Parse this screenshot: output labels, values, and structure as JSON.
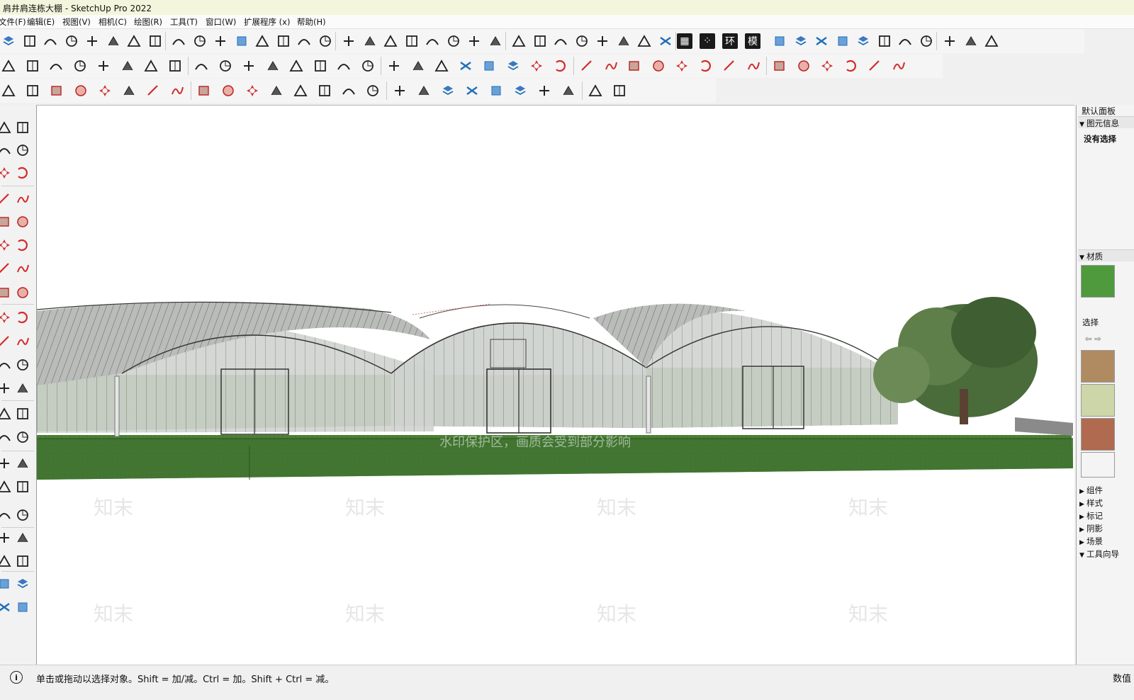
{
  "window": {
    "title": "肩井肩连栋大棚 - SketchUp Pro 2022"
  },
  "menu": [
    "文件(F)",
    "编辑(E)",
    "视图(V)",
    "相机(C)",
    "绘图(R)",
    "工具(T)",
    "窗口(W)",
    "扩展程序 (x)",
    "帮助(H)"
  ],
  "toolbar_text_buttons": [
    "环",
    "模"
  ],
  "icons": {
    "row1": [
      "sandbox-icon",
      "grid-icon",
      "line-tool-icon",
      "bar-chart-icon",
      "joint-push-icon",
      "dim-icon",
      "curve-icon",
      "curve2-icon",
      "arch-icon",
      "spiral-icon",
      "flowify-icon",
      "layer-icon",
      "pen-curve-icon",
      "stack-icon",
      "stack2-icon",
      "box-icon",
      "stamp-icon",
      "arc-line-icon",
      "chain-icon",
      "wave-icon",
      "spring-icon",
      "slope-icon",
      "comb-icon",
      "rail-icon",
      "mirror-icon",
      "dots-grid-icon",
      "panel-icon",
      "compass-icon",
      "brush-icon",
      "table-icon",
      "star-field-icon",
      "iso-cube-icon",
      "cube-outline-icon",
      "face-icon",
      "shade-icon",
      "layers-icon",
      "texture-icon",
      "house1-icon",
      "door-icon",
      "house-icon",
      "gate-icon",
      "house2-icon",
      "shed-icon"
    ],
    "row2": [
      "new-icon",
      "open-icon",
      "save-icon",
      "cut-icon",
      "copy-icon",
      "paste-icon",
      "erase-icon",
      "undo-icon",
      "redo-icon",
      "print-icon",
      "model-info-icon",
      "tape-icon",
      "axis-icon",
      "protractor-icon",
      "text-icon",
      "axes-icon",
      "figure-icon",
      "component-icon",
      "group-icon",
      "layer-stack-icon",
      "blue-cube-icon",
      "blue-cube2-icon",
      "pencil-icon",
      "freehand-icon",
      "rectangle-icon",
      "rotated-rect-icon",
      "circle-icon",
      "polygon-icon",
      "arc-icon",
      "arc2-icon",
      "arc3-icon",
      "pie-icon",
      "move-icon",
      "pushpull-icon",
      "rotate-icon",
      "followme-icon",
      "scale-icon",
      "offset-icon"
    ],
    "row3": [
      "zoom-icon",
      "select-icon",
      "eraser-icon",
      "pencil-line-icon",
      "arc-tool-icon",
      "shape-icon",
      "pushpull2-icon",
      "followme2-icon",
      "move2-icon",
      "rotate2-icon",
      "scale2-icon",
      "tape2-icon",
      "text2-icon",
      "paint-icon",
      "orbit-icon",
      "pan-icon",
      "zoom2-icon",
      "zoom-extents-icon",
      "sandbox2-icon",
      "sandbox3-icon",
      "sandbox4-icon",
      "sandbox5-icon",
      "user-icon",
      "ruby-icon",
      "ext-warehouse-icon",
      "ext-manager-icon"
    ]
  },
  "right_panel": {
    "title": "默认面板",
    "entity_info": "图元信息",
    "no_selection": "没有选择",
    "materials": "材质",
    "select_tab": "选择",
    "collapsed_sections": [
      "组件",
      "样式",
      "标记",
      "阴影",
      "场景",
      "工具向导"
    ]
  },
  "watermark": {
    "brand": "知末",
    "notice": "水印保护区，画质会受到部分影响"
  },
  "status": {
    "hint": "单击或拖动以选择对象。Shift = 加/减。Ctrl = 加。Shift + Ctrl = 减。",
    "right_label": "数值"
  },
  "colors": {
    "titlebar": "#f3f6dc",
    "ground_green": "#4f8a3a",
    "sketchup_red": "#d42a2a",
    "sandbox_blue": "#1e6fb8"
  }
}
